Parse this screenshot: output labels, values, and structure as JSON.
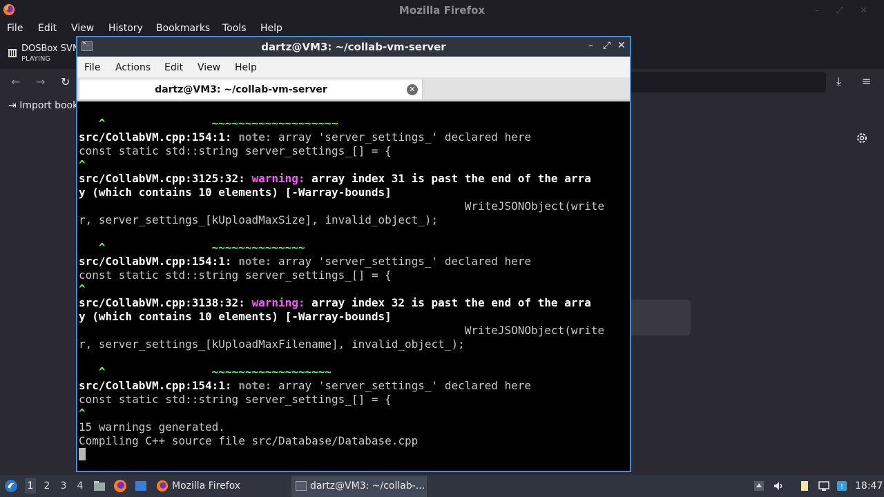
{
  "firefox": {
    "window_title": "Mozilla Firefox",
    "window_controls": "– ⤢ ✕",
    "menu": [
      {
        "label": "File"
      },
      {
        "label": "Edit"
      },
      {
        "label": "View"
      },
      {
        "label": "History"
      },
      {
        "label": "Bookmarks"
      },
      {
        "label": "Tools"
      },
      {
        "label": "Help"
      }
    ],
    "tab": {
      "title": "DOSBox SVN",
      "status": "PLAYING"
    },
    "bookmarks": {
      "import_label": "Import book"
    }
  },
  "terminal": {
    "window_title": "dartz@VM3: ~/collab-vm-server",
    "menu": [
      {
        "label": "File"
      },
      {
        "label": "Actions"
      },
      {
        "label": "Edit"
      },
      {
        "label": "View"
      },
      {
        "label": "Help"
      }
    ],
    "tab_title": "dartz@VM3: ~/collab-vm-server",
    "lines": [
      {
        "parts": [
          {
            "t": "   ^                ~~~~~~~~~~~~~~~~~~~",
            "c": "grn"
          }
        ]
      },
      {
        "parts": [
          {
            "t": "src/CollabVM.cpp:154:1: ",
            "c": "b"
          },
          {
            "t": "note:",
            "c": "note"
          },
          {
            "t": " array 'server_settings_' declared here",
            "c": ""
          }
        ]
      },
      {
        "parts": [
          {
            "t": "const static std::string server_settings_[] = {",
            "c": ""
          }
        ]
      },
      {
        "parts": [
          {
            "t": "^",
            "c": "grn"
          }
        ]
      },
      {
        "parts": [
          {
            "t": "src/CollabVM.cpp:3125:32: ",
            "c": "b"
          },
          {
            "t": "warning:",
            "c": "warn"
          },
          {
            "t": " array index 31 is past the end of the arra",
            "c": "b"
          }
        ]
      },
      {
        "parts": [
          {
            "t": "y (which contains 10 elements) [-Warray-bounds]",
            "c": "b"
          }
        ]
      },
      {
        "parts": [
          {
            "t": "                                                          WriteJSONObject(write",
            "c": ""
          }
        ]
      },
      {
        "parts": [
          {
            "t": "r, server_settings_[kUploadMaxSize], invalid_object_);",
            "c": ""
          }
        ]
      },
      {
        "parts": [
          {
            "t": "",
            "c": ""
          }
        ]
      },
      {
        "parts": [
          {
            "t": "   ^                ~~~~~~~~~~~~~~",
            "c": "grn"
          }
        ]
      },
      {
        "parts": [
          {
            "t": "src/CollabVM.cpp:154:1: ",
            "c": "b"
          },
          {
            "t": "note:",
            "c": "note"
          },
          {
            "t": " array 'server_settings_' declared here",
            "c": ""
          }
        ]
      },
      {
        "parts": [
          {
            "t": "const static std::string server_settings_[] = {",
            "c": ""
          }
        ]
      },
      {
        "parts": [
          {
            "t": "^",
            "c": "grn"
          }
        ]
      },
      {
        "parts": [
          {
            "t": "src/CollabVM.cpp:3138:32: ",
            "c": "b"
          },
          {
            "t": "warning:",
            "c": "warn"
          },
          {
            "t": " array index 32 is past the end of the arra",
            "c": "b"
          }
        ]
      },
      {
        "parts": [
          {
            "t": "y (which contains 10 elements) [-Warray-bounds]",
            "c": "b"
          }
        ]
      },
      {
        "parts": [
          {
            "t": "                                                          WriteJSONObject(write",
            "c": ""
          }
        ]
      },
      {
        "parts": [
          {
            "t": "r, server_settings_[kUploadMaxFilename], invalid_object_);",
            "c": ""
          }
        ]
      },
      {
        "parts": [
          {
            "t": "",
            "c": ""
          }
        ]
      },
      {
        "parts": [
          {
            "t": "   ^                ~~~~~~~~~~~~~~~~~~",
            "c": "grn"
          }
        ]
      },
      {
        "parts": [
          {
            "t": "src/CollabVM.cpp:154:1: ",
            "c": "b"
          },
          {
            "t": "note:",
            "c": "note"
          },
          {
            "t": " array 'server_settings_' declared here",
            "c": ""
          }
        ]
      },
      {
        "parts": [
          {
            "t": "const static std::string server_settings_[] = {",
            "c": ""
          }
        ]
      },
      {
        "parts": [
          {
            "t": "^",
            "c": "grn"
          }
        ]
      },
      {
        "parts": [
          {
            "t": "15 warnings generated.",
            "c": ""
          }
        ]
      },
      {
        "parts": [
          {
            "t": "Compiling C++ source file src/Database/Database.cpp",
            "c": ""
          }
        ]
      }
    ]
  },
  "taskbar": {
    "workspaces": [
      "1",
      "2",
      "3",
      "4"
    ],
    "active_workspace": "1",
    "tasks": [
      {
        "label": "Mozilla Firefox",
        "icon": "firefox-icon"
      },
      {
        "label": "dartz@VM3: ~/collab-...",
        "icon": "terminal-icon"
      }
    ],
    "clock": "18:47"
  },
  "colors": {
    "terminal_border": "#3d8ee0",
    "warning": "#ff55ff",
    "caret": "#55ff55",
    "taskbar": "#2f343f"
  }
}
